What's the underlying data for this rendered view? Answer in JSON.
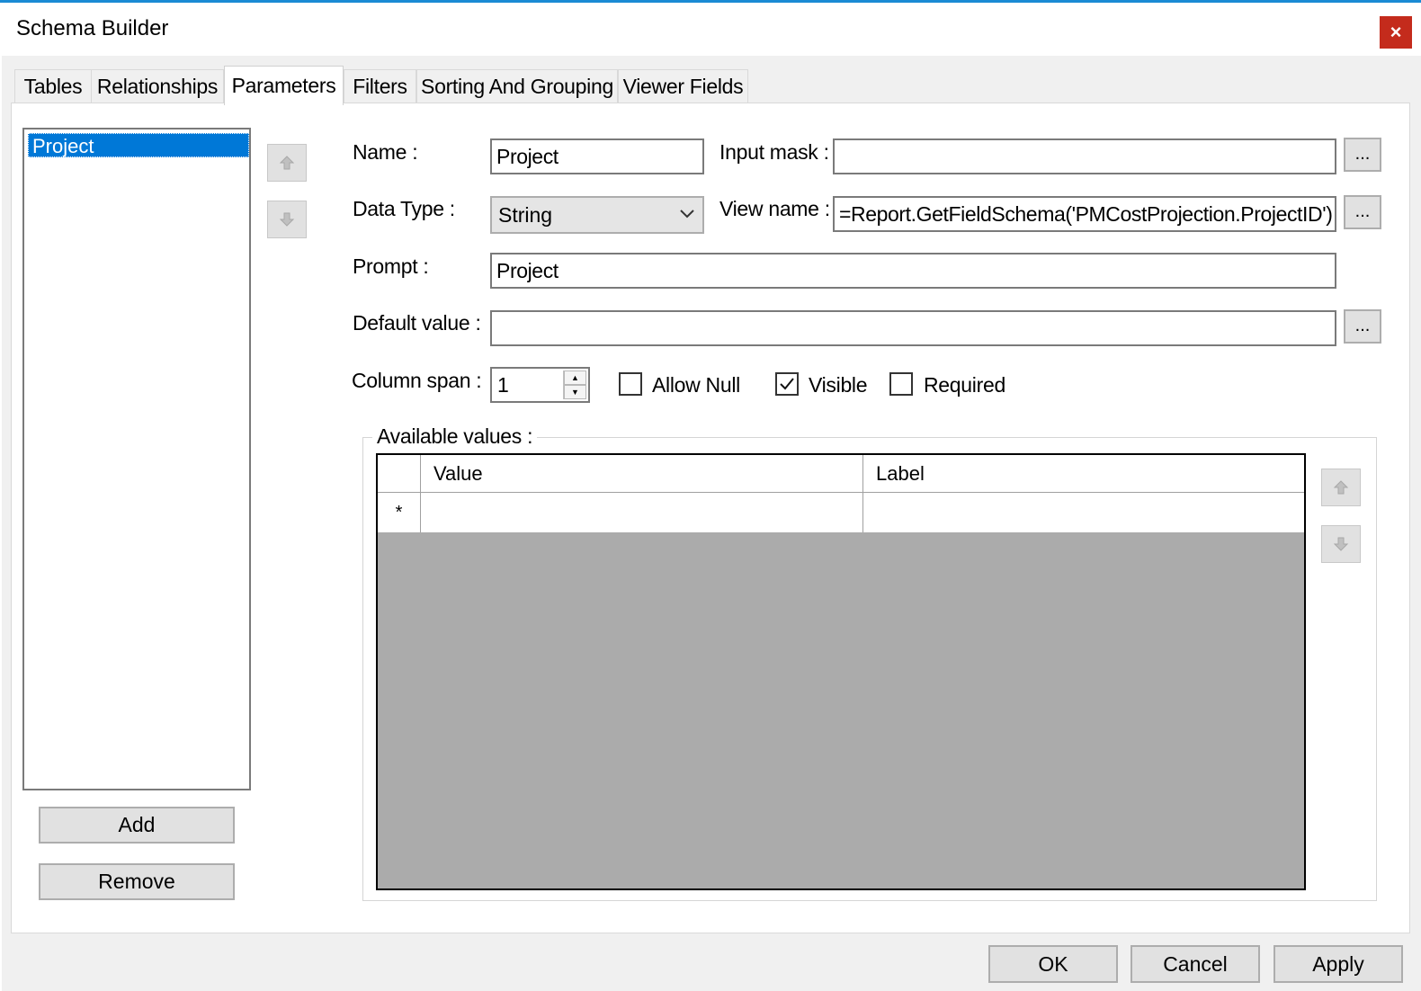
{
  "window": {
    "title": "Schema Builder",
    "close_glyph": "×"
  },
  "tabs": [
    {
      "label": "Tables",
      "active": false
    },
    {
      "label": "Relationships",
      "active": false
    },
    {
      "label": "Parameters",
      "active": true
    },
    {
      "label": "Filters",
      "active": false
    },
    {
      "label": "Sorting And Grouping",
      "active": false
    },
    {
      "label": "Viewer Fields",
      "active": false
    }
  ],
  "parameter_list": {
    "items": [
      "Project"
    ],
    "selected_index": 0,
    "add_label": "Add",
    "remove_label": "Remove"
  },
  "form": {
    "name_label": "Name :",
    "name_value": "Project",
    "data_type_label": "Data Type :",
    "data_type_value": "String",
    "input_mask_label": "Input mask :",
    "input_mask_value": "",
    "view_name_label": "View name :",
    "view_name_value": "=Report.GetFieldSchema('PMCostProjection.ProjectID')",
    "prompt_label": "Prompt :",
    "prompt_value": "Project",
    "default_value_label": "Default value :",
    "default_value_value": "",
    "column_span_label": "Column span :",
    "column_span_value": "1",
    "ellipsis_label": "...",
    "allow_null_label": "Allow Null",
    "allow_null_checked": false,
    "visible_label": "Visible",
    "visible_checked": true,
    "required_label": "Required",
    "required_checked": false
  },
  "available_values": {
    "title": "Available values :",
    "columns": [
      "Value",
      "Label"
    ],
    "new_row_marker": "*",
    "rows": []
  },
  "footer": {
    "ok_label": "OK",
    "cancel_label": "Cancel",
    "apply_label": "Apply"
  },
  "colors": {
    "accent": "#0078d7",
    "close": "#c42b1c",
    "grid_bg": "#ababab"
  }
}
